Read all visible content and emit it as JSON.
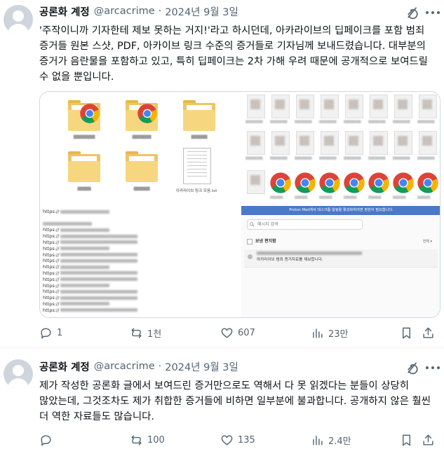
{
  "tweets": [
    {
      "display_name": "공론화 계정",
      "handle": "@arcacrime",
      "separator": "·",
      "date": "2024년 9월 3일",
      "text": "'주작이니까 기자한테 제보 못하는 거지!'라고 하시던데, 아카라이브의 딥페이크를 포함 범죄 증거들 원본 스샷, PDF, 아카이브 링크 수준의 증거들로 기자님께 보내드렸습니다. 대부분의 증거가 음란물을 포함하고 있고, 특히 딥페이크는 2차 가해 우려 때문에 공개적으로 보여드릴 수 없을 뿐입니다.",
      "media": {
        "text_file_label": "아카라이브 링크 모음.txt",
        "links_prefix": "https://",
        "mail_banner": "Proton Mail에서 데스크톱 알림을 활성화하려면 권한이 필요합니다.",
        "mail_search_placeholder": "메시지 검색",
        "mail_folder": "보낸 편지함",
        "mail_sort": "전체 ▾",
        "mail_subject": "아카라이브 범죄 증거자료를 제보합니다."
      },
      "stats": {
        "replies": "1",
        "reposts": "1천",
        "likes": "607",
        "views": "23만"
      }
    },
    {
      "display_name": "공론화 계정",
      "handle": "@arcacrime",
      "separator": "·",
      "date": "2024년 9월 3일",
      "text": "제가 작성한 공론화 글에서 보여드린 증거만으로도 역해서 다 못 읽겠다는 분들이 상당히 많았는데, 그것조차도 제가 취합한 증거들에 비하면 일부분에 불과합니다. 공개하지 않은 훨씬 더 역한 자료들도 많습니다.",
      "stats": {
        "replies": "",
        "reposts": "100",
        "likes": "135",
        "views": "2.4만"
      }
    }
  ],
  "icons": {
    "grok": "grok-icon",
    "more": "more-icon",
    "reply": "reply-icon",
    "repost": "repost-icon",
    "like": "like-icon",
    "views": "views-icon",
    "bookmark": "bookmark-icon",
    "share": "share-icon"
  },
  "colors": {
    "text": "#0f1419",
    "secondary": "#536471",
    "border": "#cfd9de",
    "proton_banner": "#4b78c8"
  }
}
